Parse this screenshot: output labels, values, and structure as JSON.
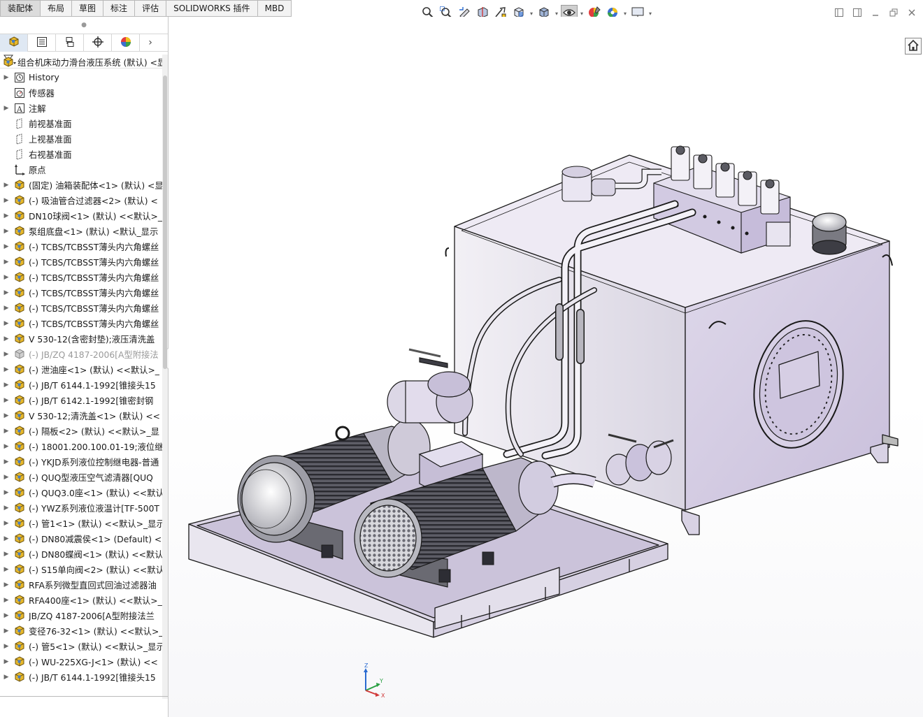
{
  "command_tabs": [
    "装配体",
    "布局",
    "草图",
    "标注",
    "评估",
    "SOLIDWORKS 插件",
    "MBD"
  ],
  "panel_tabs": [
    {
      "name": "feature-manager-tab",
      "icon": "assembly-icon"
    },
    {
      "name": "property-manager-tab",
      "icon": "property-list-icon"
    },
    {
      "name": "configuration-manager-tab",
      "icon": "configuration-icon"
    },
    {
      "name": "dimxpert-tab",
      "icon": "target-icon"
    },
    {
      "name": "display-manager-tab",
      "icon": "appearance-sphere-icon"
    }
  ],
  "tree": {
    "root": "组合机床动力滑台液压系统 (默认) <显",
    "items": [
      {
        "label": "History",
        "icon": "history",
        "expand": true
      },
      {
        "label": "传感器",
        "icon": "sensor",
        "expand": false
      },
      {
        "label": "注解",
        "icon": "annotation",
        "expand": true
      },
      {
        "label": "前视基准面",
        "icon": "plane",
        "expand": false
      },
      {
        "label": "上视基准面",
        "icon": "plane",
        "expand": false
      },
      {
        "label": "右视基准面",
        "icon": "plane",
        "expand": false
      },
      {
        "label": "原点",
        "icon": "origin",
        "expand": false
      },
      {
        "label": "(固定) 油箱装配体<1> (默认) <显",
        "icon": "assembly",
        "expand": true
      },
      {
        "label": "(-) 吸油管合过滤器<2> (默认) <",
        "icon": "assembly",
        "expand": true
      },
      {
        "label": "DN10球阀<1> (默认) <<默认>_",
        "icon": "assembly",
        "expand": true
      },
      {
        "label": "泵组底盘<1> (默认) <默认_显示",
        "icon": "assembly",
        "expand": true
      },
      {
        "label": "(-) TCBS/TCBSST薄头内六角螺丝",
        "icon": "assembly",
        "expand": true
      },
      {
        "label": "(-) TCBS/TCBSST薄头内六角螺丝",
        "icon": "assembly",
        "expand": true
      },
      {
        "label": "(-) TCBS/TCBSST薄头内六角螺丝",
        "icon": "assembly",
        "expand": true
      },
      {
        "label": "(-) TCBS/TCBSST薄头内六角螺丝",
        "icon": "assembly",
        "expand": true
      },
      {
        "label": "(-) TCBS/TCBSST薄头内六角螺丝",
        "icon": "assembly",
        "expand": true
      },
      {
        "label": "(-) TCBS/TCBSST薄头内六角螺丝",
        "icon": "assembly",
        "expand": true
      },
      {
        "label": "V 530-12(含密封垫);液压清洗盖",
        "icon": "assembly",
        "expand": true
      },
      {
        "label": "(-) JB/ZQ 4187-2006[A型附接法",
        "icon": "assembly-gray",
        "expand": true,
        "dim": true
      },
      {
        "label": "(-) 泄油座<1> (默认) <<默认>_",
        "icon": "assembly",
        "expand": true
      },
      {
        "label": "(-) JB/T 6144.1-1992[锥接头15",
        "icon": "assembly",
        "expand": true
      },
      {
        "label": "(-) JB/T 6142.1-1992[锥密封钢",
        "icon": "assembly",
        "expand": true
      },
      {
        "label": "V 530-12;清洗盖<1> (默认) <<",
        "icon": "assembly",
        "expand": true
      },
      {
        "label": "(-) 隔板<2> (默认) <<默认>_显",
        "icon": "assembly",
        "expand": true
      },
      {
        "label": "(-) 18001.200.100.01-19;液位继",
        "icon": "assembly",
        "expand": true
      },
      {
        "label": "(-) YKJD系列液位控制继电器-普通",
        "icon": "assembly",
        "expand": true
      },
      {
        "label": "(-) QUQ型液压空气滤清器[QUQ",
        "icon": "assembly",
        "expand": true
      },
      {
        "label": "(-) QUQ3.0座<1> (默认) <<默认",
        "icon": "assembly",
        "expand": true
      },
      {
        "label": "(-) YWZ系列液位液温计[TF-500T",
        "icon": "assembly",
        "expand": true
      },
      {
        "label": "(-) 管1<1> (默认) <<默认>_显示",
        "icon": "assembly",
        "expand": true
      },
      {
        "label": "(-) DN80减震侯<1> (Default) <",
        "icon": "assembly",
        "expand": true
      },
      {
        "label": "(-) DN80蝶阀<1> (默认) <<默认_",
        "icon": "assembly",
        "expand": true
      },
      {
        "label": "(-) S15单向阀<2> (默认) <<默认",
        "icon": "assembly",
        "expand": true
      },
      {
        "label": "RFA系列微型直回式回油过滤器油",
        "icon": "assembly",
        "expand": true
      },
      {
        "label": "RFA400座<1> (默认) <<默认>_",
        "icon": "assembly",
        "expand": true
      },
      {
        "label": "JB/ZQ 4187-2006[A型附接法兰",
        "icon": "assembly",
        "expand": true
      },
      {
        "label": "变径76-32<1> (默认) <<默认>_",
        "icon": "assembly",
        "expand": true
      },
      {
        "label": "(-) 管5<1> (默认) <<默认>_显示",
        "icon": "assembly",
        "expand": true
      },
      {
        "label": "(-) WU-225XG-J<1> (默认) <<",
        "icon": "assembly",
        "expand": true
      },
      {
        "label": "(-) JB/T 6144.1-1992[锥接头15",
        "icon": "assembly",
        "expand": true
      }
    ]
  },
  "view_toolbar": [
    {
      "name": "zoom-to-fit-icon",
      "caret": false
    },
    {
      "name": "zoom-to-area-icon",
      "caret": false
    },
    {
      "name": "previous-view-icon",
      "caret": false
    },
    {
      "name": "section-view-icon",
      "caret": false
    },
    {
      "name": "dynamic-annotation-icon",
      "caret": false
    },
    {
      "name": "view-orientation-icon",
      "caret": true
    },
    {
      "name": "display-style-icon",
      "caret": true
    },
    {
      "name": "hide-show-items-icon",
      "caret": true,
      "active": true
    },
    {
      "name": "edit-appearance-icon",
      "caret": false
    },
    {
      "name": "apply-scene-icon",
      "caret": true
    },
    {
      "name": "view-settings-icon",
      "caret": true
    }
  ],
  "triad": {
    "x": "X",
    "y": "Y",
    "z": "Z"
  },
  "colors": {
    "model_fill": "#e6e1ef",
    "model_shade": "#cfc6df",
    "model_edge": "#1a1a1a",
    "tree_icon_yellow": "#e8b82a",
    "tree_icon_blue": "#4a7fc0"
  }
}
